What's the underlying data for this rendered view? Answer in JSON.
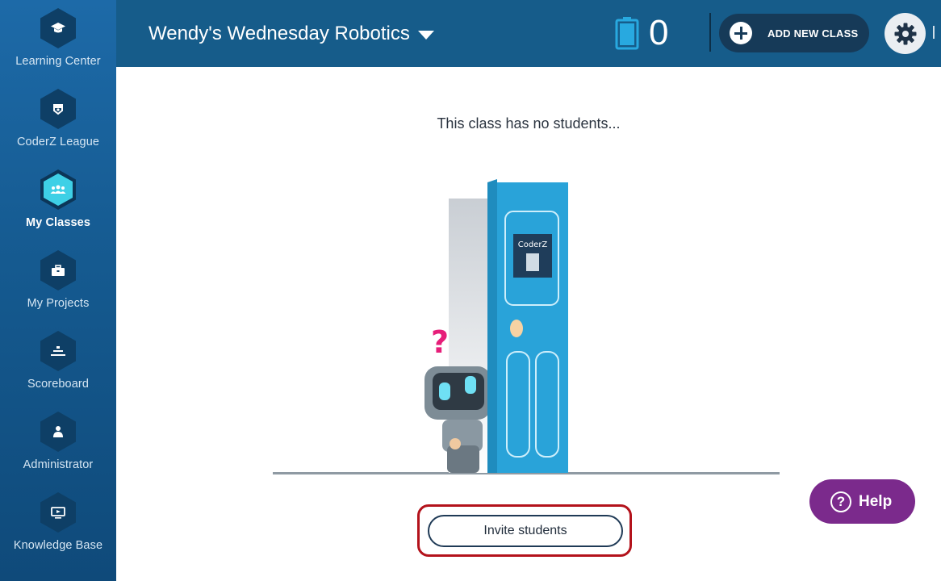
{
  "sidebar": {
    "items": [
      {
        "label": "Learning Center",
        "icon": "graduation-cap-icon"
      },
      {
        "label": "CoderZ League",
        "icon": "league-badge-icon"
      },
      {
        "label": "My Classes",
        "icon": "classes-group-icon",
        "active": true
      },
      {
        "label": "My Projects",
        "icon": "briefcase-icon"
      },
      {
        "label": "Scoreboard",
        "icon": "podium-icon"
      },
      {
        "label": "Administrator",
        "icon": "user-icon"
      },
      {
        "label": "Knowledge Base",
        "icon": "monitor-icon"
      }
    ]
  },
  "header": {
    "class_name": "Wendy's Wednesday Robotics",
    "battery_count": "0",
    "add_class_label": "ADD NEW CLASS"
  },
  "main": {
    "empty_message": "This class has no students...",
    "invite_label": "Invite students",
    "door_sign": "CoderZ"
  },
  "help": {
    "label": "Help",
    "icon_char": "?"
  },
  "colors": {
    "sidebar": "#155a90",
    "topbar": "#165c8a",
    "active_accent": "#3ed0e6",
    "help_purple": "#7b2a8c",
    "highlight_red": "#b3121b",
    "door_blue": "#29a3d9"
  }
}
